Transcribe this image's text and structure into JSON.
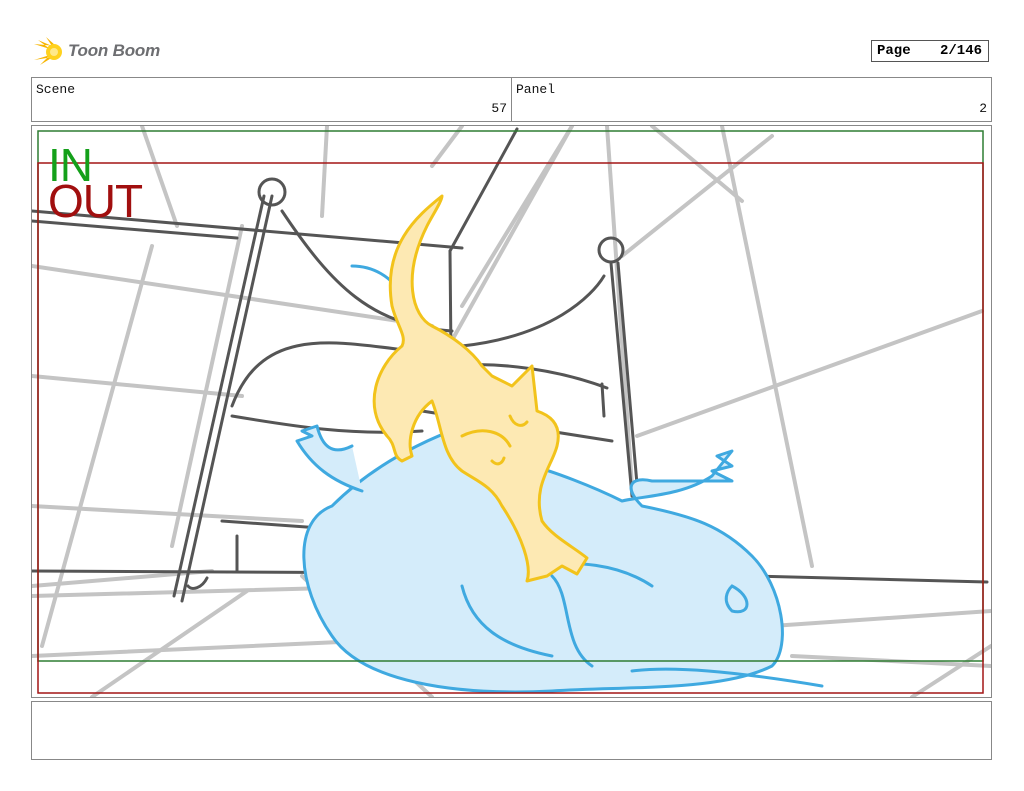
{
  "header": {
    "logo_text": "Toon Boom",
    "page_label": "Page",
    "page_value": "2/146"
  },
  "info": {
    "scene_label": "Scene",
    "scene_value": "57",
    "panel_label": "Panel",
    "panel_value": "2"
  },
  "panel": {
    "in_label": "IN",
    "out_label": "OUT",
    "colors": {
      "in_frame": "#2e7d32",
      "out_frame": "#a31515",
      "cat_fill": "#fde9b3",
      "cat_stroke": "#f2c31b",
      "dog_fill": "#d4ecfa",
      "dog_stroke": "#3fa9e0",
      "sketch_dark": "#555555",
      "sketch_light": "#c4c4c4"
    },
    "icons": [
      "toon-boom-logo-icon"
    ]
  },
  "notes": {
    "text": ""
  }
}
